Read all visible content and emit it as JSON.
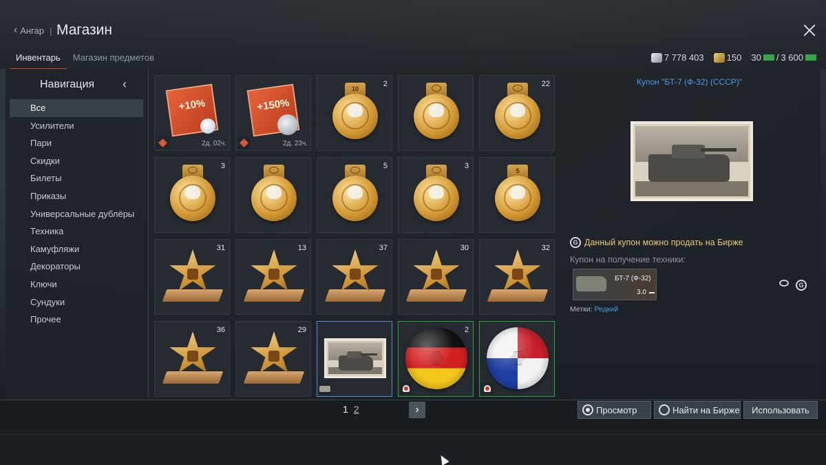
{
  "header": {
    "back_label": "Ангар",
    "separator": "|",
    "title": "Магазин"
  },
  "tabs": [
    {
      "label": "Инвентарь",
      "active": true
    },
    {
      "label": "Магазин предметов",
      "active": false
    }
  ],
  "currency": {
    "silver_lions": "7 778 403",
    "golden_eagles": "150",
    "money_current": "30",
    "money_separator": "/",
    "money_total": "3 600"
  },
  "sidebar": {
    "title": "Навигация",
    "items": [
      {
        "label": "Все",
        "active": true
      },
      {
        "label": "Усилители"
      },
      {
        "label": "Пари"
      },
      {
        "label": "Скидки"
      },
      {
        "label": "Билеты"
      },
      {
        "label": "Приказы"
      },
      {
        "label": "Универсальные дублёры"
      },
      {
        "label": "Техника"
      },
      {
        "label": "Камуфляжи"
      },
      {
        "label": "Декораторы"
      },
      {
        "label": "Ключи"
      },
      {
        "label": "Сундуки"
      },
      {
        "label": "Прочее"
      }
    ]
  },
  "grid": {
    "tiles": [
      {
        "kind": "booster",
        "text": "+10%",
        "overlay": "bulb-icon",
        "time": "2д. 02ч."
      },
      {
        "kind": "booster",
        "text": "+150%",
        "overlay": "lion-icon",
        "time": "2д. 23ч."
      },
      {
        "kind": "medal",
        "count": "2",
        "ribbon_number": "10"
      },
      {
        "kind": "medal",
        "count": ""
      },
      {
        "kind": "medal",
        "count": "22"
      },
      {
        "kind": "medal",
        "count": "3"
      },
      {
        "kind": "medal",
        "count": ""
      },
      {
        "kind": "medal",
        "count": "5"
      },
      {
        "kind": "medal",
        "count": "3"
      },
      {
        "kind": "medal",
        "count": "",
        "ribbon_number": "5"
      },
      {
        "kind": "star",
        "count": "31"
      },
      {
        "kind": "star",
        "count": "13"
      },
      {
        "kind": "star",
        "count": "37"
      },
      {
        "kind": "star",
        "count": "30"
      },
      {
        "kind": "star",
        "count": "32"
      },
      {
        "kind": "star",
        "count": "36"
      },
      {
        "kind": "star",
        "count": "29"
      },
      {
        "kind": "tank-photo",
        "count": "",
        "selected": true
      },
      {
        "kind": "ball-germany",
        "count": "2"
      },
      {
        "kind": "ball-panama",
        "count": ""
      }
    ]
  },
  "pagination": {
    "current": "1",
    "other": "2",
    "next": "›"
  },
  "detail": {
    "title": "Купон \"БТ-7 (Ф-32) (СССР)\"",
    "market_note": "Данный купон можно продать на Бирже",
    "coupon_label": "Купон на получение техники:",
    "vehicle_name": "БТ-7 (Ф-32)",
    "vehicle_br": "3.0",
    "tags_label": "Метки:",
    "tags_value": "Редкий"
  },
  "actions": {
    "view": "Просмотр",
    "find": "Найти на Бирже",
    "use": "Использовать"
  },
  "colors": {
    "accent_tab": "#c64a2e",
    "link_blue": "#4e9be0",
    "note_gold": "#e9c77a",
    "selected_green": "#2fa23b"
  }
}
